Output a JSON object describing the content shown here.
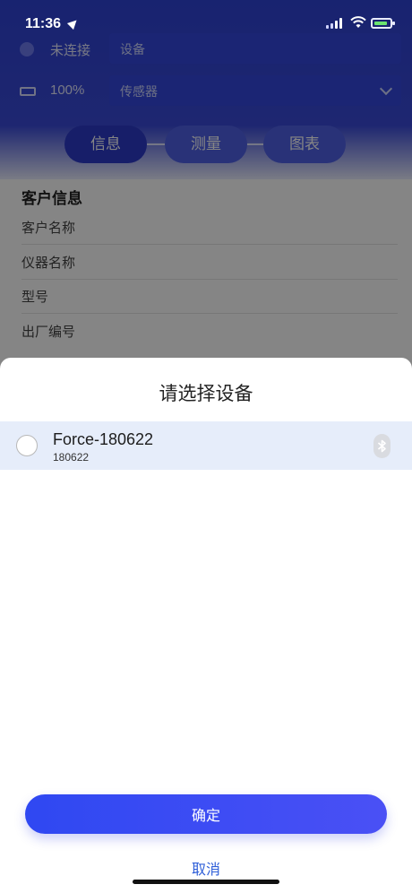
{
  "status_bar": {
    "time": "11:36"
  },
  "background_app": {
    "connection_status": "未连接",
    "device_select_placeholder": "设备",
    "battery_level": "100%",
    "sensor_select_placeholder": "传感器",
    "tabs": [
      {
        "label": "信息",
        "active": true
      },
      {
        "label": "测量",
        "active": false
      },
      {
        "label": "图表",
        "active": false
      }
    ],
    "section_title": "客户信息",
    "fields": [
      "客户名称",
      "仪器名称",
      "型号",
      "出厂编号"
    ]
  },
  "dialog": {
    "title": "请选择设备",
    "devices": [
      {
        "name": "Force-180622",
        "id": "180622",
        "selected": false
      }
    ],
    "confirm_label": "确定",
    "cancel_label": "取消"
  },
  "colors": {
    "accent": "#3a4cf2",
    "row_highlight": "#e6edfa",
    "cancel_text": "#2f5fd8"
  }
}
